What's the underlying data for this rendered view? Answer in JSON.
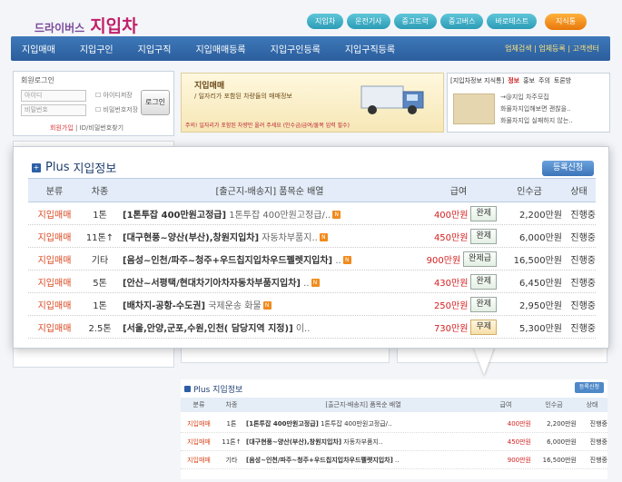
{
  "site": {
    "logo_small": "드라이버스",
    "logo_big": "지입차",
    "top_tabs": [
      "지입차",
      "운전기사",
      "중고트럭",
      "중고버스",
      "바로테스트"
    ],
    "top_tab_special": "지식통",
    "nav": [
      "지입매매",
      "지입구인",
      "지입구직",
      "지입매매등록",
      "지입구인등록",
      "지입구직등록"
    ],
    "nav_right": "업체검색 | 업체등록 | 고객센터",
    "login": {
      "title": "회원로그인",
      "id_placeholder": "아이디",
      "pw_placeholder": "비밀번호",
      "save_id": "아이디저장",
      "save_pw": "비밀번호저장",
      "button": "로그인",
      "join": "회원가입",
      "find": "ID/비밀번호찾기"
    },
    "banner": {
      "title": "지입매매",
      "subtitle": "/ 일자리가 포함된 차량들의 매매정보",
      "footer": "주의! 일자리가 포함된 차량만 올려 주세요 (인수금/급여/물목 입력 필수)"
    },
    "notice": {
      "tabs": [
        "[지입차정보 지식통]",
        "정보",
        "홍보",
        "주의",
        "토론방"
      ],
      "items": [
        "→@지입 차주모집",
        "화물차지입해보면 괜찮을..",
        "화물차지입 실패하지 않는.."
      ]
    }
  },
  "panel": {
    "title_plus": "Plus",
    "title_text": "지입정보",
    "register_button": "등록신청",
    "columns": [
      "분류",
      "차종",
      "[출근지-배송지] 품목순 배열",
      "급여",
      "인수금",
      "상태"
    ],
    "rows": [
      {
        "category": "지입매매",
        "vehicle": "1톤",
        "route": "[1톤투잡 400만원고정급]",
        "desc": "1톤투잡 400만원고정급/..",
        "pay": "400만원",
        "pay_type": "완제",
        "amount": "2,200만원",
        "status": "진행중"
      },
      {
        "category": "지입매매",
        "vehicle": "11톤↑",
        "route": "[대구현풍~양산(부산),창원지입차]",
        "desc": "자동차부품지..",
        "pay": "450만원",
        "pay_type": "완제",
        "amount": "6,000만원",
        "status": "진행중"
      },
      {
        "category": "지입매매",
        "vehicle": "기타",
        "route": "[음성~인천/파주~청주+우드칩지입차우드펠렛지입차]",
        "desc": "..",
        "pay": "900만원",
        "pay_type": "완제급",
        "amount": "16,500만원",
        "status": "진행중"
      },
      {
        "category": "지입매매",
        "vehicle": "5톤",
        "route": "[안산~서평택/현대차기아차자동차부품지입차]",
        "desc": "..",
        "pay": "430만원",
        "pay_type": "완제",
        "amount": "6,450만원",
        "status": "진행중"
      },
      {
        "category": "지입매매",
        "vehicle": "1톤",
        "route": "[배차지-공항-수도권]",
        "desc": "국제운송 화물",
        "pay": "250만원",
        "pay_type": "완제",
        "amount": "2,950만원",
        "status": "진행중"
      },
      {
        "category": "지입매매",
        "vehicle": "2.5톤",
        "route": "[서울,안양,군포,수원,인천( 담당지역 지정)]",
        "desc": "이..",
        "pay": "730만원",
        "pay_type": "무제",
        "amount": "5,300만원",
        "status": "진행중"
      }
    ]
  },
  "mini": {
    "title": "Plus 지입정보",
    "register_button": "등록신청",
    "columns": [
      "분류",
      "차종",
      "[출근지-배송지] 품목순 배열",
      "급여",
      "인수금",
      "상태"
    ],
    "rows": [
      {
        "category": "지입매매",
        "vehicle": "1톤",
        "route": "[1톤투잡 400만원고정급]",
        "desc": "1톤투잡 400만원고정급/..",
        "pay": "400만원",
        "pay_type": "완제",
        "amount": "2,200만원",
        "status": "진행중"
      },
      {
        "category": "지입매매",
        "vehicle": "11톤↑",
        "route": "[대구현풍~양산(부산),창원지입차]",
        "desc": "자동차부품지..",
        "pay": "450만원",
        "pay_type": "완제",
        "amount": "6,000만원",
        "status": "진행중"
      },
      {
        "category": "지입매매",
        "vehicle": "기타",
        "route": "[음성~인천/파주~청주+우드칩지입차우드펠렛지입차]",
        "desc": "..",
        "pay": "900만원",
        "pay_type": "완제급",
        "amount": "16,500만원",
        "status": "진행중"
      }
    ]
  }
}
